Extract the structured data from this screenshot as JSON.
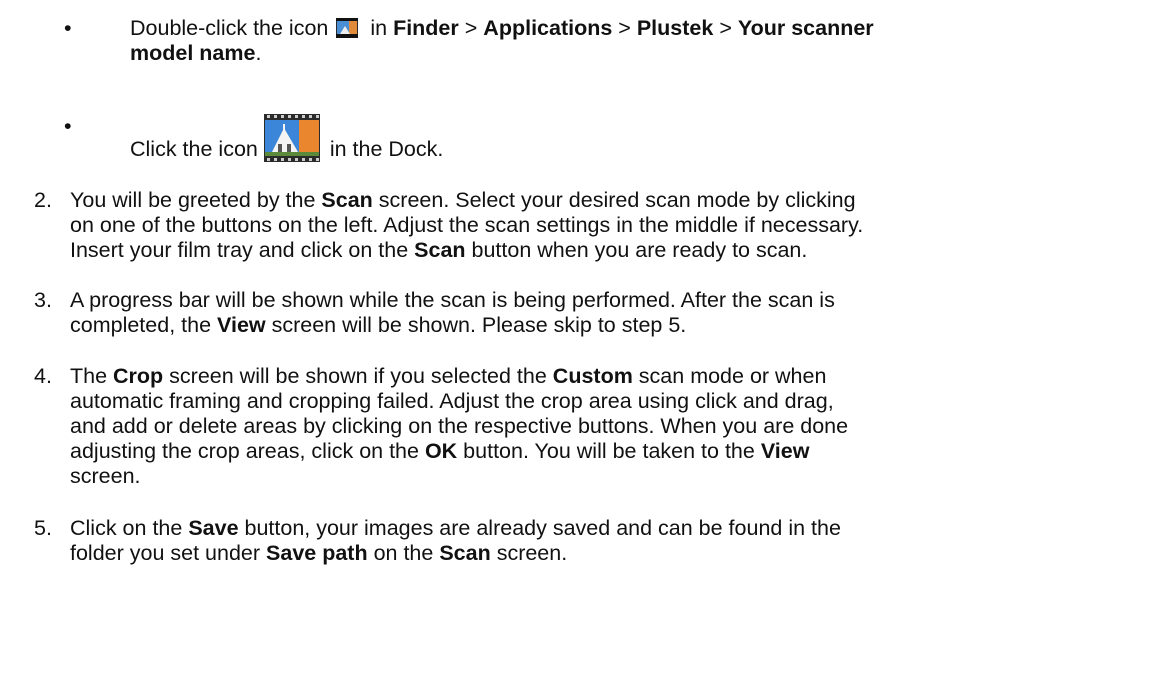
{
  "bullets": [
    {
      "pre": "Double-click the icon",
      "post": "in",
      "finder": "Finder",
      "sep": ">",
      "applications": "Applications",
      "plustek": "Plustek",
      "model": "Your scanner",
      "model2": "model name",
      "period": "."
    },
    {
      "pre": "Click the icon",
      "post": "in the Dock."
    }
  ],
  "steps": [
    {
      "num": "2.",
      "l1a": "You will be greeted by the ",
      "l1b": "Scan",
      "l1c": " screen. Select your desired scan mode by clicking",
      "l2": "on one of the buttons on the left. Adjust the scan settings in the middle if necessary.",
      "l3a": "Insert your film tray and click on the ",
      "l3b": "Scan",
      "l3c": " button when you are ready to scan."
    },
    {
      "num": "3.",
      "l1": "A progress bar will be shown while the scan is being performed. After the scan is",
      "l2a": "completed, the ",
      "l2b": "View",
      "l2c": " screen will be shown. Please skip to step 5."
    },
    {
      "num": "4.",
      "l1a": "The ",
      "l1b": "Crop",
      "l1c": " screen will be shown if you selected the ",
      "l1d": "Custom",
      "l1e": " scan mode or when",
      "l2": "automatic framing and cropping failed. Adjust the crop area using click and drag,",
      "l3": "and add or delete areas by clicking on the respective buttons. When you are done",
      "l4a": "adjusting the crop areas, click on the ",
      "l4b": "OK",
      "l4c": " button. You will be taken to the ",
      "l4d": "View",
      "l5": "screen."
    },
    {
      "num": "5.",
      "l1a": "Click on the ",
      "l1b": "Save",
      "l1c": " button, your images are already saved and can be found in the",
      "l2a": "folder you set under ",
      "l2b": "Save path",
      "l2c": " on the ",
      "l2d": "Scan",
      "l2e": " screen."
    }
  ],
  "bullet_char": "•",
  "icons": [
    "app-icon-small",
    "app-icon-large"
  ]
}
